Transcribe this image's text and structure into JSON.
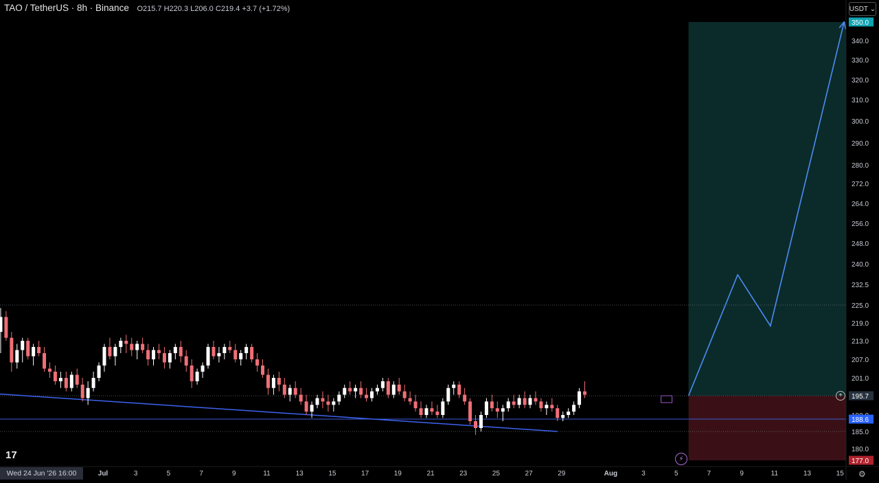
{
  "header": {
    "symbol": "TAO / TetherUS · 8h · Binance",
    "open": "O215.7",
    "high": "H220.3",
    "low": "L206.0",
    "close": "C219.4",
    "change": "+3.7 (+1.72%)"
  },
  "currency_button": "USDT",
  "crosshair_date": "Wed 24 Jun '26   16:00",
  "logo": "17",
  "colors": {
    "up": "#ffffff",
    "down": "#ef6f77",
    "trendline": "#3d63f0",
    "target_zone": "#0b2b2a",
    "stop_zone": "#3a1016",
    "projection": "#4c8cf5",
    "level_line": "#3b5bdb",
    "price_tag": "#26323e",
    "blue_tag": "#2962ff",
    "red_tag": "#b0232d",
    "teal_tag": "#0fa3b1"
  },
  "chart_data": {
    "type": "candlestick",
    "title": "TAO / TetherUS · 8h · Binance",
    "ylim": [
      177,
      350
    ],
    "y_ticks": [
      {
        "value": 350.0,
        "label": "350.0",
        "highlight": "teal"
      },
      {
        "value": 340.0,
        "label": "340.0"
      },
      {
        "value": 330.0,
        "label": "330.0"
      },
      {
        "value": 320.0,
        "label": "320.0"
      },
      {
        "value": 310.0,
        "label": "310.0"
      },
      {
        "value": 300.0,
        "label": "300.0"
      },
      {
        "value": 290.0,
        "label": "290.0"
      },
      {
        "value": 280.0,
        "label": "280.0"
      },
      {
        "value": 272.0,
        "label": "272.0"
      },
      {
        "value": 264.0,
        "label": "264.0"
      },
      {
        "value": 256.0,
        "label": "256.0"
      },
      {
        "value": 248.0,
        "label": "248.0"
      },
      {
        "value": 240.0,
        "label": "240.0"
      },
      {
        "value": 232.5,
        "label": "232.5"
      },
      {
        "value": 225.0,
        "label": "225.0"
      },
      {
        "value": 219.0,
        "label": "219.0"
      },
      {
        "value": 213.0,
        "label": "213.0"
      },
      {
        "value": 207.0,
        "label": "207.0"
      },
      {
        "value": 201.0,
        "label": "201.0"
      },
      {
        "value": 195.7,
        "label": "195.7",
        "highlight": "dark"
      },
      {
        "value": 190.0,
        "label": "190.0"
      },
      {
        "value": 188.6,
        "label": "188.6",
        "highlight": "blue"
      },
      {
        "value": 185.0,
        "label": "185.0"
      },
      {
        "value": 180.0,
        "label": "180.0"
      },
      {
        "value": 177.0,
        "label": "177.0",
        "highlight": "red"
      }
    ],
    "x_ticks": [
      {
        "label": "Jul",
        "bold": true
      },
      {
        "label": "3"
      },
      {
        "label": "5"
      },
      {
        "label": "7"
      },
      {
        "label": "9"
      },
      {
        "label": "11"
      },
      {
        "label": "13"
      },
      {
        "label": "15"
      },
      {
        "label": "17"
      },
      {
        "label": "19"
      },
      {
        "label": "21"
      },
      {
        "label": "23"
      },
      {
        "label": "25"
      },
      {
        "label": "27"
      },
      {
        "label": "29"
      },
      {
        "label": "Aug",
        "bold": true
      },
      {
        "label": "3"
      },
      {
        "label": "5"
      },
      {
        "label": "7"
      },
      {
        "label": "9"
      },
      {
        "label": "11"
      },
      {
        "label": "13"
      },
      {
        "label": "15"
      }
    ],
    "x_tick_days": [
      0,
      2,
      4,
      6,
      8,
      10,
      12,
      14,
      16,
      18,
      20,
      22,
      24,
      26,
      28,
      31,
      33,
      35,
      37,
      39,
      41,
      43,
      45
    ],
    "candles_start_day": -6.25,
    "candle_interval_days": 0.3333,
    "candles": [
      [
        216.0,
        224.0,
        209.0,
        221.0
      ],
      [
        221.0,
        223.0,
        213.0,
        214.0
      ],
      [
        214.0,
        216.0,
        203.0,
        206.0
      ],
      [
        206.0,
        212.0,
        204.0,
        210.0
      ],
      [
        210.0,
        214.0,
        206.0,
        213.0
      ],
      [
        213.0,
        214.0,
        207.0,
        208.0
      ],
      [
        208.0,
        212.0,
        205.0,
        211.0
      ],
      [
        211.0,
        213.0,
        208.0,
        209.0
      ],
      [
        209.0,
        211.0,
        203.0,
        204.0
      ],
      [
        204.0,
        206.0,
        201.0,
        203.0
      ],
      [
        203.0,
        205.0,
        199.0,
        200.0
      ],
      [
        200.0,
        203.0,
        198.0,
        201.0
      ],
      [
        201.0,
        203.0,
        197.0,
        198.0
      ],
      [
        198.0,
        203.0,
        197.0,
        202.0
      ],
      [
        202.0,
        204.0,
        198.0,
        199.0
      ],
      [
        199.0,
        201.0,
        194.0,
        195.0
      ],
      [
        195.0,
        200.0,
        193.0,
        198.0
      ],
      [
        198.0,
        203.0,
        197.0,
        201.0
      ],
      [
        201.0,
        206.0,
        200.0,
        205.0
      ],
      [
        205.0,
        212.0,
        203.0,
        211.0
      ],
      [
        211.0,
        214.0,
        207.0,
        208.0
      ],
      [
        208.0,
        212.0,
        205.0,
        211.0
      ],
      [
        211.0,
        214.0,
        209.0,
        213.0
      ],
      [
        213.0,
        215.0,
        209.0,
        212.0
      ],
      [
        212.0,
        214.0,
        208.0,
        210.0
      ],
      [
        210.0,
        213.0,
        207.0,
        212.0
      ],
      [
        212.0,
        214.0,
        209.0,
        210.0
      ],
      [
        210.0,
        212.0,
        205.0,
        207.0
      ],
      [
        207.0,
        211.0,
        205.0,
        210.0
      ],
      [
        210.0,
        212.0,
        207.0,
        209.0
      ],
      [
        209.0,
        211.0,
        204.0,
        206.0
      ],
      [
        206.0,
        210.0,
        204.0,
        209.0
      ],
      [
        209.0,
        212.0,
        207.0,
        211.0
      ],
      [
        211.0,
        213.0,
        206.0,
        208.0
      ],
      [
        208.0,
        210.0,
        203.0,
        205.0
      ],
      [
        205.0,
        207.0,
        198.0,
        200.0
      ],
      [
        200.0,
        204.0,
        199.0,
        203.0
      ],
      [
        203.0,
        206.0,
        201.0,
        205.0
      ],
      [
        205.0,
        212.0,
        204.0,
        211.0
      ],
      [
        211.0,
        213.0,
        207.0,
        208.0
      ],
      [
        208.0,
        211.0,
        206.0,
        209.0
      ],
      [
        209.0,
        212.0,
        207.0,
        211.0
      ],
      [
        211.0,
        213.0,
        209.0,
        210.0
      ],
      [
        210.0,
        212.0,
        206.0,
        207.0
      ],
      [
        207.0,
        210.0,
        205.0,
        209.0
      ],
      [
        209.0,
        212.0,
        207.0,
        211.0
      ],
      [
        211.0,
        212.0,
        206.0,
        207.0
      ],
      [
        207.0,
        209.0,
        203.0,
        205.0
      ],
      [
        205.0,
        207.0,
        201.0,
        202.0
      ],
      [
        202.0,
        204.0,
        196.0,
        198.0
      ],
      [
        198.0,
        202.0,
        196.0,
        201.0
      ],
      [
        201.0,
        203.0,
        197.0,
        199.0
      ],
      [
        199.0,
        201.0,
        195.0,
        196.0
      ],
      [
        196.0,
        199.0,
        194.0,
        198.0
      ],
      [
        198.0,
        200.0,
        195.0,
        196.0
      ],
      [
        196.0,
        198.0,
        193.0,
        194.0
      ],
      [
        194.0,
        196.0,
        190.0,
        191.0
      ],
      [
        191.0,
        194.0,
        189.0,
        193.0
      ],
      [
        193.0,
        196.0,
        192.0,
        195.0
      ],
      [
        195.0,
        197.0,
        192.0,
        194.0
      ],
      [
        194.0,
        196.0,
        191.0,
        193.0
      ],
      [
        193.0,
        195.0,
        191.0,
        194.0
      ],
      [
        194.0,
        197.0,
        193.0,
        196.0
      ],
      [
        196.0,
        199.0,
        195.0,
        198.0
      ],
      [
        198.0,
        200.0,
        196.0,
        197.0
      ],
      [
        197.0,
        199.0,
        195.0,
        198.0
      ],
      [
        198.0,
        200.0,
        195.0,
        196.0
      ],
      [
        196.0,
        198.0,
        194.0,
        195.0
      ],
      [
        195.0,
        198.0,
        194.0,
        197.0
      ],
      [
        197.0,
        199.0,
        196.0,
        198.0
      ],
      [
        198.0,
        201.0,
        197.0,
        200.0
      ],
      [
        200.0,
        201.0,
        195.0,
        196.0
      ],
      [
        196.0,
        200.0,
        195.0,
        199.0
      ],
      [
        199.0,
        201.0,
        196.0,
        197.0
      ],
      [
        197.0,
        199.0,
        194.0,
        195.0
      ],
      [
        195.0,
        197.0,
        193.0,
        194.0
      ],
      [
        194.0,
        196.0,
        191.0,
        192.0
      ],
      [
        192.0,
        194.0,
        189.0,
        190.0
      ],
      [
        190.0,
        193.0,
        189.0,
        192.0
      ],
      [
        192.0,
        194.0,
        190.0,
        191.0
      ],
      [
        191.0,
        193.0,
        189.0,
        190.0
      ],
      [
        190.0,
        195.0,
        189.0,
        194.0
      ],
      [
        194.0,
        199.0,
        193.0,
        198.0
      ],
      [
        198.0,
        200.0,
        196.0,
        199.0
      ],
      [
        199.0,
        200.0,
        195.0,
        196.0
      ],
      [
        196.0,
        198.0,
        193.0,
        194.0
      ],
      [
        194.0,
        195.0,
        187.0,
        188.0
      ],
      [
        188.0,
        190.0,
        184.0,
        186.0
      ],
      [
        186.0,
        191.0,
        185.0,
        190.0
      ],
      [
        190.0,
        195.0,
        189.0,
        194.0
      ],
      [
        194.0,
        196.0,
        191.0,
        192.0
      ],
      [
        192.0,
        194.0,
        189.0,
        191.0
      ],
      [
        191.0,
        193.0,
        188.0,
        192.0
      ],
      [
        192.0,
        195.0,
        191.0,
        194.0
      ],
      [
        194.0,
        196.0,
        192.0,
        193.0
      ],
      [
        193.0,
        196.0,
        192.0,
        195.0
      ],
      [
        195.0,
        197.0,
        192.0,
        193.0
      ],
      [
        193.0,
        196.0,
        192.0,
        195.0
      ],
      [
        195.0,
        197.0,
        193.0,
        194.0
      ],
      [
        194.0,
        195.0,
        191.0,
        192.0
      ],
      [
        192.0,
        194.0,
        190.0,
        193.0
      ],
      [
        193.0,
        195.0,
        191.0,
        192.0
      ],
      [
        192.0,
        193.0,
        188.0,
        189.0
      ],
      [
        189.0,
        191.0,
        188.0,
        190.0
      ],
      [
        190.0,
        192.0,
        189.0,
        191.0
      ],
      [
        191.0,
        194.0,
        190.0,
        193.0
      ],
      [
        193.0,
        198.0,
        192.0,
        197.0
      ],
      [
        197.0,
        200.0,
        195.0,
        196.0
      ]
    ],
    "drawings": {
      "descending_trendline": [
        {
          "day": -7.5,
          "value": 196.6
        },
        {
          "day": 27.75,
          "value": 185.0
        }
      ],
      "support_level": 188.6,
      "dashed_levels": [
        225.0,
        195.7,
        185.0
      ],
      "long_position": {
        "start_day": 35.75,
        "entry": 195.7,
        "target": 350.0,
        "stop": 177.0
      },
      "projection_path": [
        {
          "day": 35.75,
          "value": 195.7
        },
        {
          "day": 38.75,
          "value": 236.0
        },
        {
          "day": 40.75,
          "value": 218.0
        },
        {
          "day": 45.25,
          "value": 350.0
        }
      ]
    }
  }
}
